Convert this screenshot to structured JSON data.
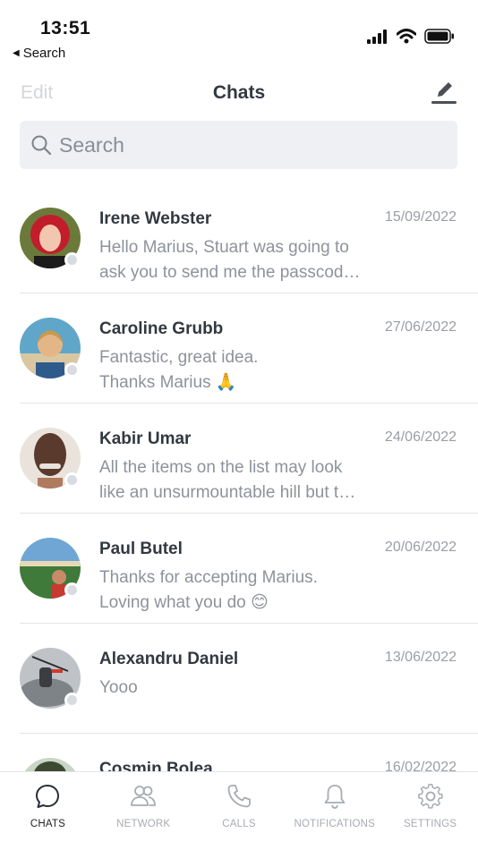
{
  "status_bar": {
    "time": "13:51",
    "back_label": "Search",
    "icons": [
      "signal-icon",
      "wifi-icon",
      "battery-icon"
    ]
  },
  "header": {
    "edit_label": "Edit",
    "title": "Chats",
    "compose_icon": "compose-icon"
  },
  "search": {
    "placeholder": "Search",
    "icon": "search-icon"
  },
  "chats": [
    {
      "name": "Irene Webster",
      "date": "15/09/2022",
      "preview": "Hello Marius, Stuart was going to\nask you to send me the passcod…",
      "avatar_colors": [
        "#c21d2b",
        "#f3c6b0",
        "#6b7a3a"
      ]
    },
    {
      "name": "Caroline Grubb",
      "date": "27/06/2022",
      "preview": "Fantastic, great idea.\nThanks Marius 🙏",
      "avatar_colors": [
        "#5fa6c9",
        "#e4b687",
        "#2e5b8c"
      ]
    },
    {
      "name": "Kabir Umar",
      "date": "24/06/2022",
      "preview": "All the items on the list may look\nlike an unsurmountable hill but t…",
      "avatar_colors": [
        "#5a3a2c",
        "#b07a5e",
        "#e9e3dc"
      ]
    },
    {
      "name": "Paul Butel",
      "date": "20/06/2022",
      "preview": "Thanks for accepting Marius.\nLoving what you do 😊",
      "avatar_colors": [
        "#6fa6d4",
        "#3f7a3a",
        "#c98a6a"
      ]
    },
    {
      "name": "Alexandru Daniel",
      "date": "13/06/2022",
      "preview": "Yooo",
      "avatar_colors": [
        "#bfc3c7",
        "#3b3d40",
        "#d23a2a"
      ]
    },
    {
      "name": "Cosmin Bolea",
      "date": "16/02/2022",
      "preview": "",
      "avatar_colors": [
        "#c9d6c4",
        "#3c4a32",
        "#d9b79a"
      ]
    }
  ],
  "tabs": [
    {
      "label": "CHATS",
      "icon": "chat-bubble-icon",
      "active": true
    },
    {
      "label": "NETWORK",
      "icon": "people-icon",
      "active": false
    },
    {
      "label": "CALLS",
      "icon": "phone-icon",
      "active": false
    },
    {
      "label": "NOTIFICATIONS",
      "icon": "bell-icon",
      "active": false
    },
    {
      "label": "SETTINGS",
      "icon": "gear-icon",
      "active": false
    }
  ],
  "colors": {
    "text_primary": "#333840",
    "text_secondary": "#8e929a",
    "search_bg": "#eef0f3",
    "presence_offline": "#d8dbe0",
    "tab_inactive": "#a7abb2"
  }
}
